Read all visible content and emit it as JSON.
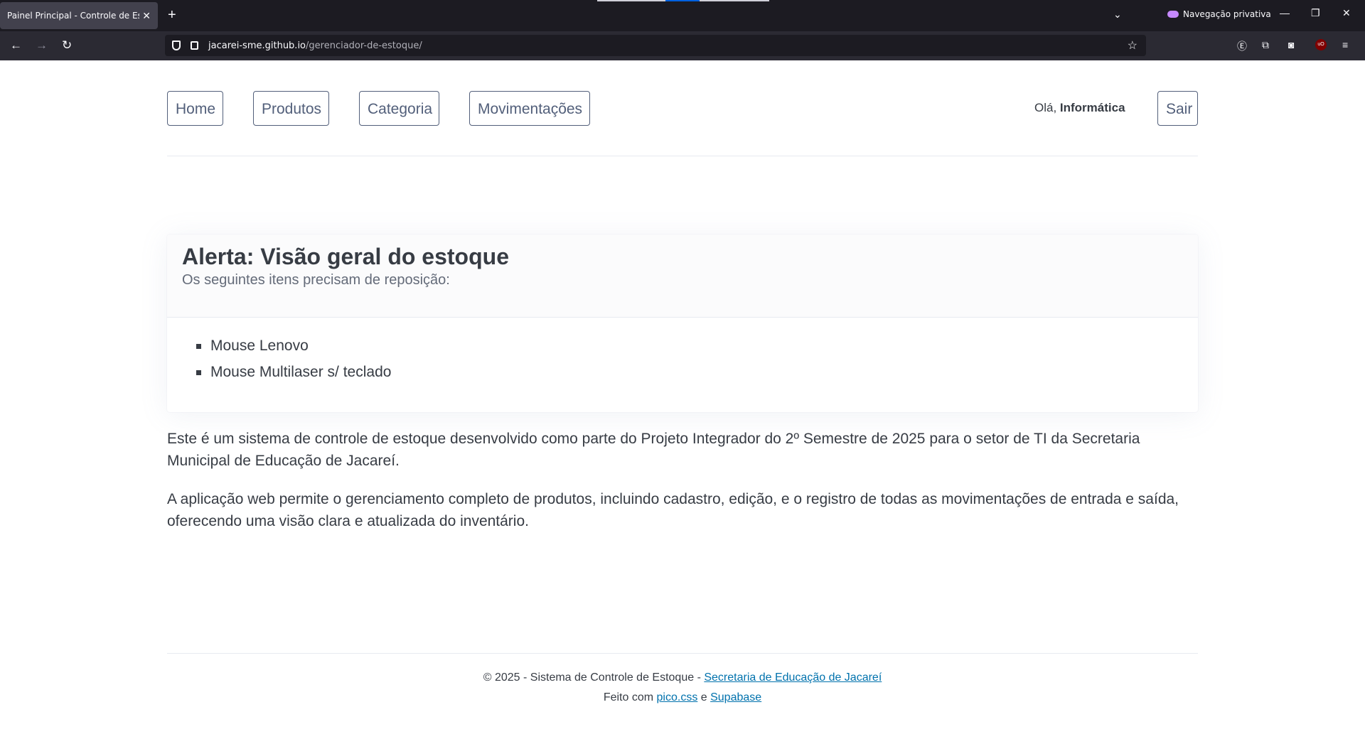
{
  "browser": {
    "tab_title": "Painel Principal - Controle de Estoque",
    "close_glyph": "✕",
    "new_tab_glyph": "+",
    "private_label": "Navegação privativa",
    "url_host": "jacarei-sme.github.io",
    "url_path": "/gerenciador-de-estoque/"
  },
  "nav": {
    "home": "Home",
    "produtos": "Produtos",
    "categoria": "Categoria",
    "movimentacoes": "Movimentações",
    "greeting_prefix": "Olá, ",
    "user_name": "Informática",
    "logout": "Sair"
  },
  "alert": {
    "title": "Alerta: Visão geral do estoque",
    "subtitle": "Os seguintes itens precisam de reposição:",
    "items": [
      "Mouse Lenovo",
      "Mouse Multilaser s/ teclado"
    ]
  },
  "body": {
    "para1": "Este é um sistema de controle de estoque desenvolvido como parte do Projeto Integrador do 2º Semestre de 2025 para o setor de TI da Secretaria Municipal de Educação de Jacareí.",
    "para2": "A aplicação web permite o gerenciamento completo de produtos, incluindo cadastro, edição, e o registro de todas as movimentações de entrada e saída, oferecendo uma visão clara e atualizada do inventário."
  },
  "footer": {
    "line1_prefix": "© 2025 - Sistema de Controle de Estoque - ",
    "line1_link": "Secretaria de Educação de Jacareí",
    "line2_prefix": "Feito com ",
    "line2_link1": "pico.css",
    "line2_mid": " e ",
    "line2_link2": "Supabase"
  },
  "colors": {
    "link": "#0172ad",
    "nav_border": "#525f7a",
    "text": "#373c44",
    "muted": "#646b79"
  },
  "icons": [
    "shield-icon",
    "lock-icon",
    "star-icon",
    "back-icon",
    "forward-icon",
    "reload-icon",
    "private-mask-icon"
  ]
}
